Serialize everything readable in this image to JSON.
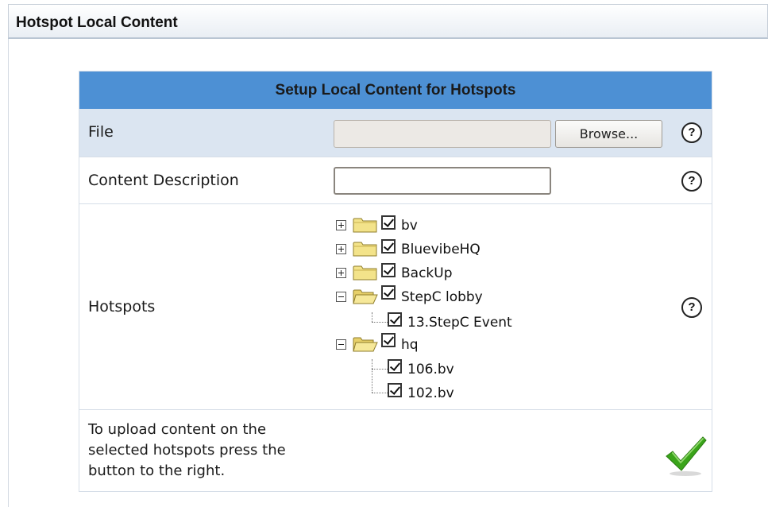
{
  "panel": {
    "title": "Hotspot Local Content"
  },
  "form": {
    "title": "Setup Local Content for Hotspots",
    "file": {
      "label": "File",
      "value": "",
      "browse_label": "Browse..."
    },
    "description": {
      "label": "Content Description",
      "value": ""
    },
    "hotspots": {
      "label": "Hotspots",
      "tree": [
        {
          "label": "bv",
          "type": "folder",
          "expander": "plus",
          "checked": true
        },
        {
          "label": "BluevibeHQ",
          "type": "folder",
          "expander": "plus",
          "checked": true
        },
        {
          "label": "BackUp",
          "type": "folder",
          "expander": "plus",
          "checked": true
        },
        {
          "label": "StepC lobby",
          "type": "folder-open",
          "expander": "minus",
          "checked": true,
          "children": [
            {
              "label": "13.StepC Event",
              "checked": true
            }
          ]
        },
        {
          "label": "hq",
          "type": "folder-open",
          "expander": "minus",
          "checked": true,
          "children": [
            {
              "label": "106.bv",
              "checked": true
            },
            {
              "label": "102.bv",
              "checked": true
            }
          ]
        }
      ]
    },
    "upload": {
      "text": "To upload content on the selected hotspots press the button to the right.",
      "button_icon": "checkmark-icon"
    },
    "help_glyph": "?"
  },
  "colors": {
    "header_blue": "#4d90d4",
    "row_alt": "#dbe5f1",
    "check_green": "#3aa41a"
  },
  "icons": {
    "help": "help-question-icon",
    "folder": "folder-icon",
    "folder_open": "folder-open-icon",
    "expand": "plus-expander-icon",
    "collapse": "minus-expander-icon"
  }
}
